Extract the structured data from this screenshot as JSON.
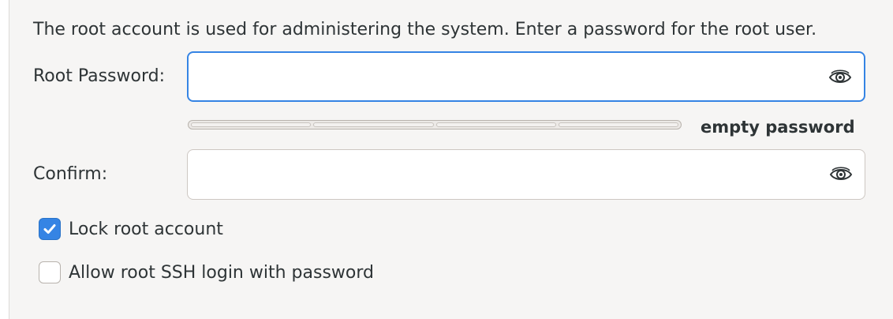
{
  "intro_text": "The root account is used for administering the system.  Enter a password for the root user.",
  "root_password": {
    "label": "Root Password:",
    "value": "",
    "reveal_icon": "eye-icon"
  },
  "strength": {
    "segments": 4,
    "level": 0,
    "text": "empty password"
  },
  "confirm": {
    "label": "Confirm:",
    "value": "",
    "reveal_icon": "eye-icon"
  },
  "lock_root": {
    "label": "Lock root account",
    "checked": true
  },
  "allow_ssh": {
    "label": "Allow root SSH login with password",
    "checked": false
  },
  "colors": {
    "accent": "#3584e4",
    "panel_bg": "#f6f5f4",
    "text": "#2e3436"
  }
}
